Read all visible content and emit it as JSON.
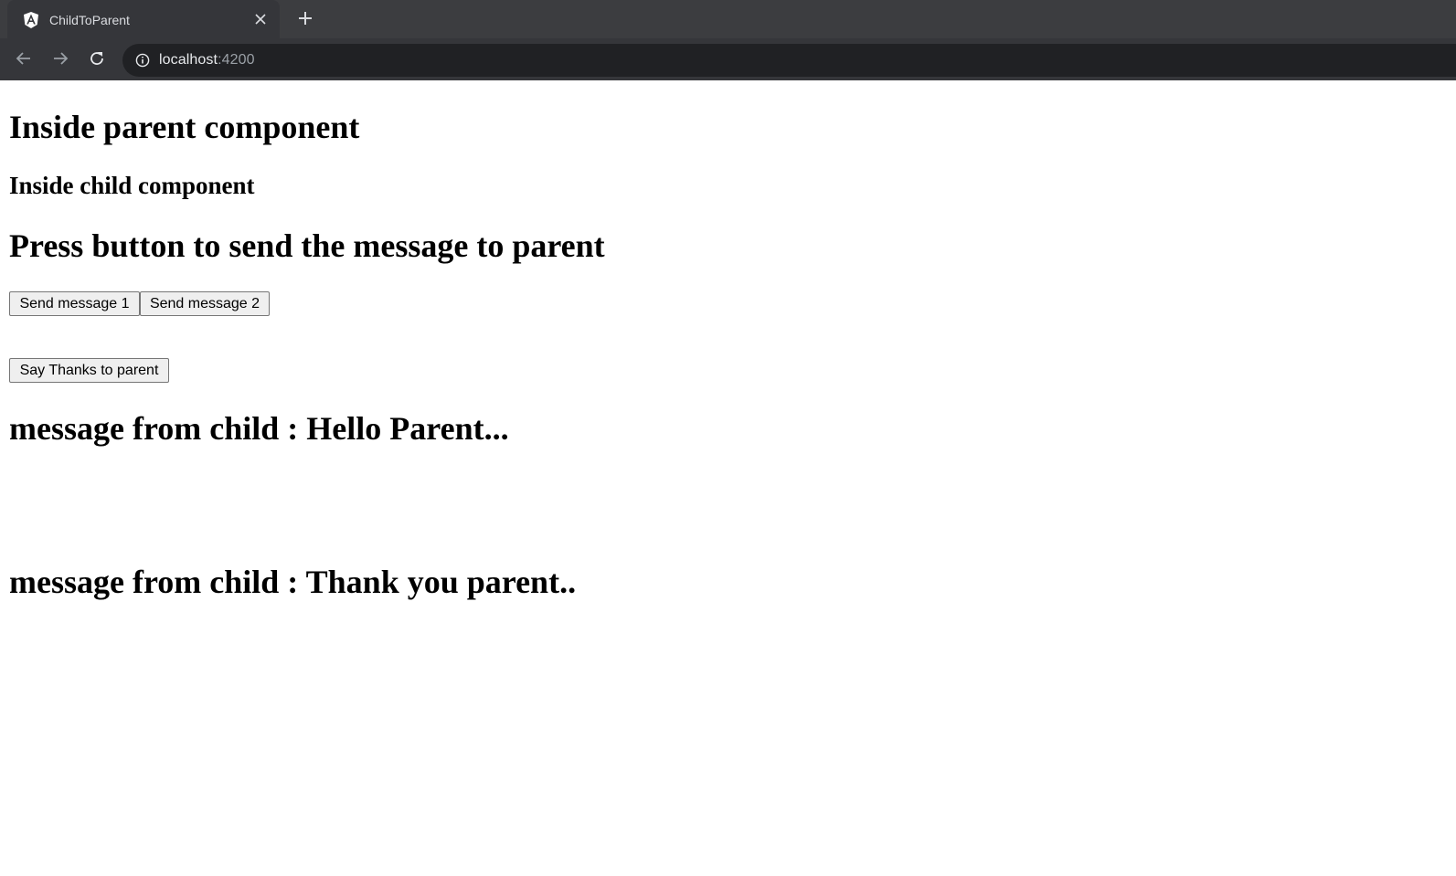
{
  "browser": {
    "tab_title": "ChildToParent",
    "url_host": "localhost",
    "url_port": ":4200",
    "icons": {
      "favicon": "angular-logo-icon",
      "close": "close-icon",
      "new_tab": "plus-icon",
      "back": "arrow-left-icon",
      "forward": "arrow-right-icon",
      "reload": "reload-icon",
      "site_info": "info-icon"
    }
  },
  "page": {
    "parent_heading": "Inside parent component",
    "child_heading": "Inside child component",
    "instruction_heading": "Press button to send the message to parent",
    "buttons": {
      "send_message_1": "Send message 1",
      "send_message_2": "Send message 2",
      "say_thanks": "Say Thanks to parent"
    },
    "message_hello": "message from child : Hello Parent...",
    "message_thanks": "message from child : Thank you parent.."
  }
}
